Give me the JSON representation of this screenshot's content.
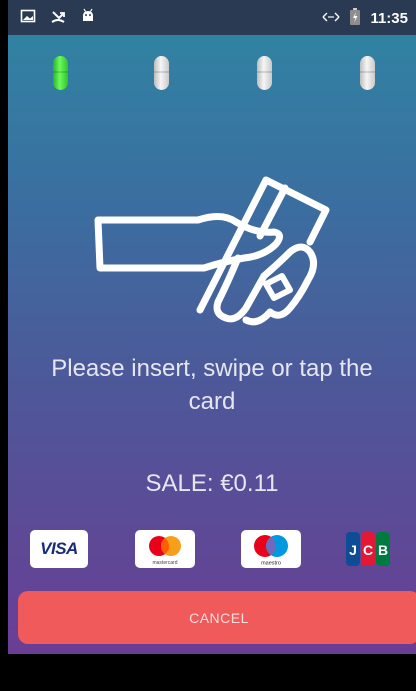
{
  "status_bar": {
    "time": "11:35",
    "left_icons": [
      "image-icon",
      "missed-call-icon",
      "android-icon"
    ],
    "right_icons": [
      "data-transfer-icon",
      "battery-charging-icon"
    ]
  },
  "progress_leds": [
    {
      "name": "led-1",
      "state": "on"
    },
    {
      "name": "led-2",
      "state": "off"
    },
    {
      "name": "led-3",
      "state": "off"
    },
    {
      "name": "led-4",
      "state": "off"
    }
  ],
  "prompt": {
    "line1": "Please insert, swipe or tap the",
    "line2": "card"
  },
  "sale": {
    "label": "SALE: €0.11"
  },
  "card_logos": {
    "visa": "VISA",
    "mastercard": "mastercard",
    "maestro": "maestro",
    "jcb": "JCB"
  },
  "actions": {
    "cancel_label": "CANCEL"
  },
  "colors": {
    "led_on": "#4fe040",
    "cancel_button": "#f05a5a",
    "status_bar": "#2a3a52"
  }
}
